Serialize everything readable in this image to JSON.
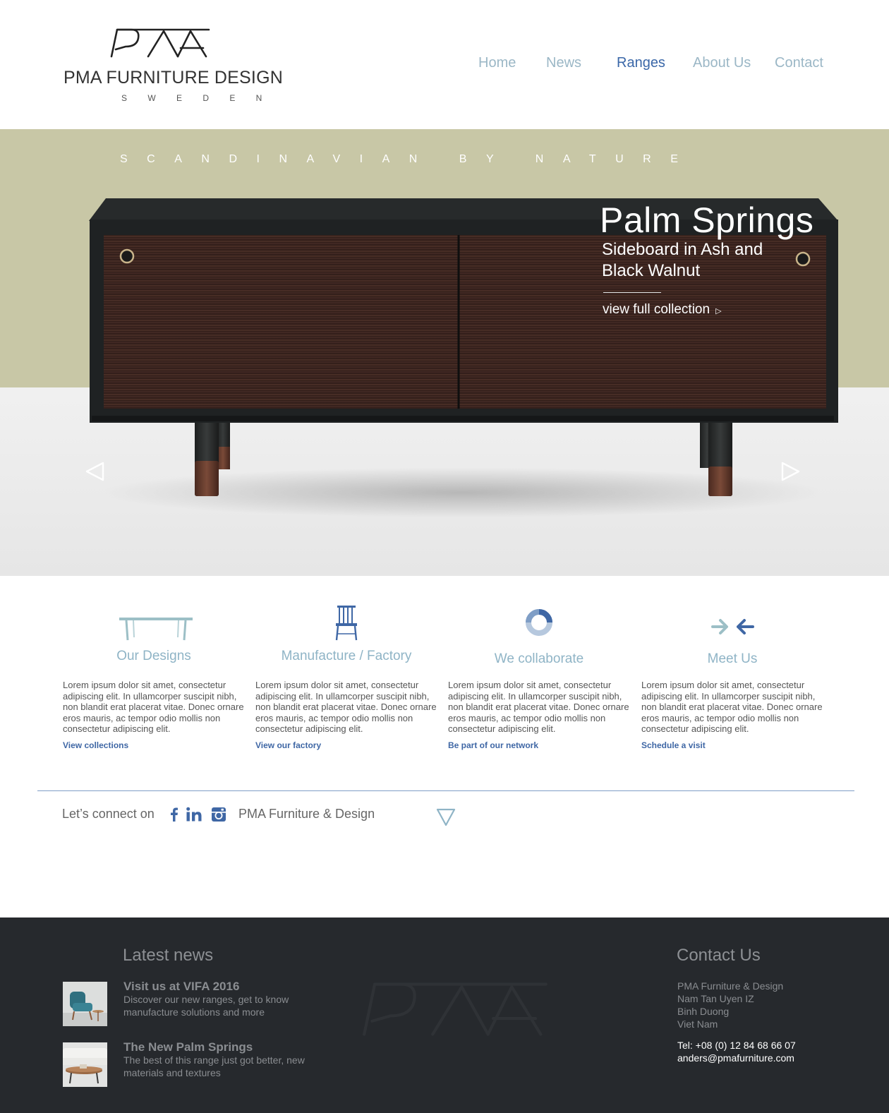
{
  "header": {
    "brand_name": "PMA FURNITURE DESIGN",
    "brand_country": "S W E D E N",
    "nav": [
      {
        "label": "Home",
        "active": false
      },
      {
        "label": "News",
        "active": false
      },
      {
        "label": "Ranges",
        "active": true
      },
      {
        "label": "About Us",
        "active": false
      },
      {
        "label": "Contact",
        "active": false
      }
    ]
  },
  "hero": {
    "tagline": "SCANDINAVIAN BY NATURE",
    "title": "Palm Springs",
    "subtitle": "Sideboard in Ash and Black Walnut",
    "link_label": "view full collection",
    "link_icon": "play-triangle-icon",
    "prev_icon": "chevron-left-icon",
    "next_icon": "chevron-right-icon",
    "band_color": "#c8c7a6"
  },
  "features": [
    {
      "icon": "table-icon",
      "title": "Our Designs",
      "text": "Lorem ipsum dolor sit amet, consectetur adipiscing elit. In ullamcorper suscipit nibh, non blandit erat placerat vitae. Donec ornare eros mauris, ac tempor odio mollis non consectetur adipiscing elit.",
      "link": "View collections"
    },
    {
      "icon": "chair-icon",
      "title": "Manufacture / Factory",
      "text": "Lorem ipsum dolor sit amet, consectetur adipiscing elit. In ullamcorper suscipit nibh, non blandit erat placerat vitae. Donec ornare eros mauris, ac tempor odio mollis non consectetur adipiscing elit.",
      "link": "View our factory"
    },
    {
      "icon": "ring-icon",
      "title": "We collaborate",
      "text": "Lorem ipsum dolor sit amet, consectetur adipiscing elit. In ullamcorper suscipit nibh, non blandit erat placerat vitae. Donec ornare eros mauris, ac tempor odio mollis non consectetur adipiscing elit.",
      "link": "Be part of our network"
    },
    {
      "icon": "converging-arrows-icon",
      "title": "Meet Us",
      "text": "Lorem ipsum dolor sit amet, consectetur adipiscing elit. In ullamcorper suscipit nibh, non blandit erat placerat vitae. Donec ornare eros mauris, ac tempor odio mollis non consectetur adipiscing elit.",
      "link": "Schedule a visit"
    }
  ],
  "connect": {
    "label": "Let’s connect on",
    "social": [
      "facebook-icon",
      "linkedin-icon",
      "instagram-icon"
    ],
    "brand": "PMA Furniture & Design"
  },
  "footer": {
    "news_title": "Latest news",
    "news": [
      {
        "title": "Visit us at VIFA 2016",
        "text": "Discover our new ranges, get to know manufacture solutions and more"
      },
      {
        "title": "The New Palm Springs",
        "text": "The best of this range just got better, new materials and textures"
      }
    ],
    "contact_title": "Contact Us",
    "address": [
      "PMA Furniture & Design",
      "Nam Tan Uyen IZ",
      "Binh Duong",
      "Viet Nam"
    ],
    "tel": "Tel: +08 (0) 12 84 68 66 07",
    "email": "anders@pmafurniture.com"
  },
  "colors": {
    "accent": "#3a67a8",
    "nav": "#9bb7c6",
    "footer_bg": "#26292d"
  }
}
